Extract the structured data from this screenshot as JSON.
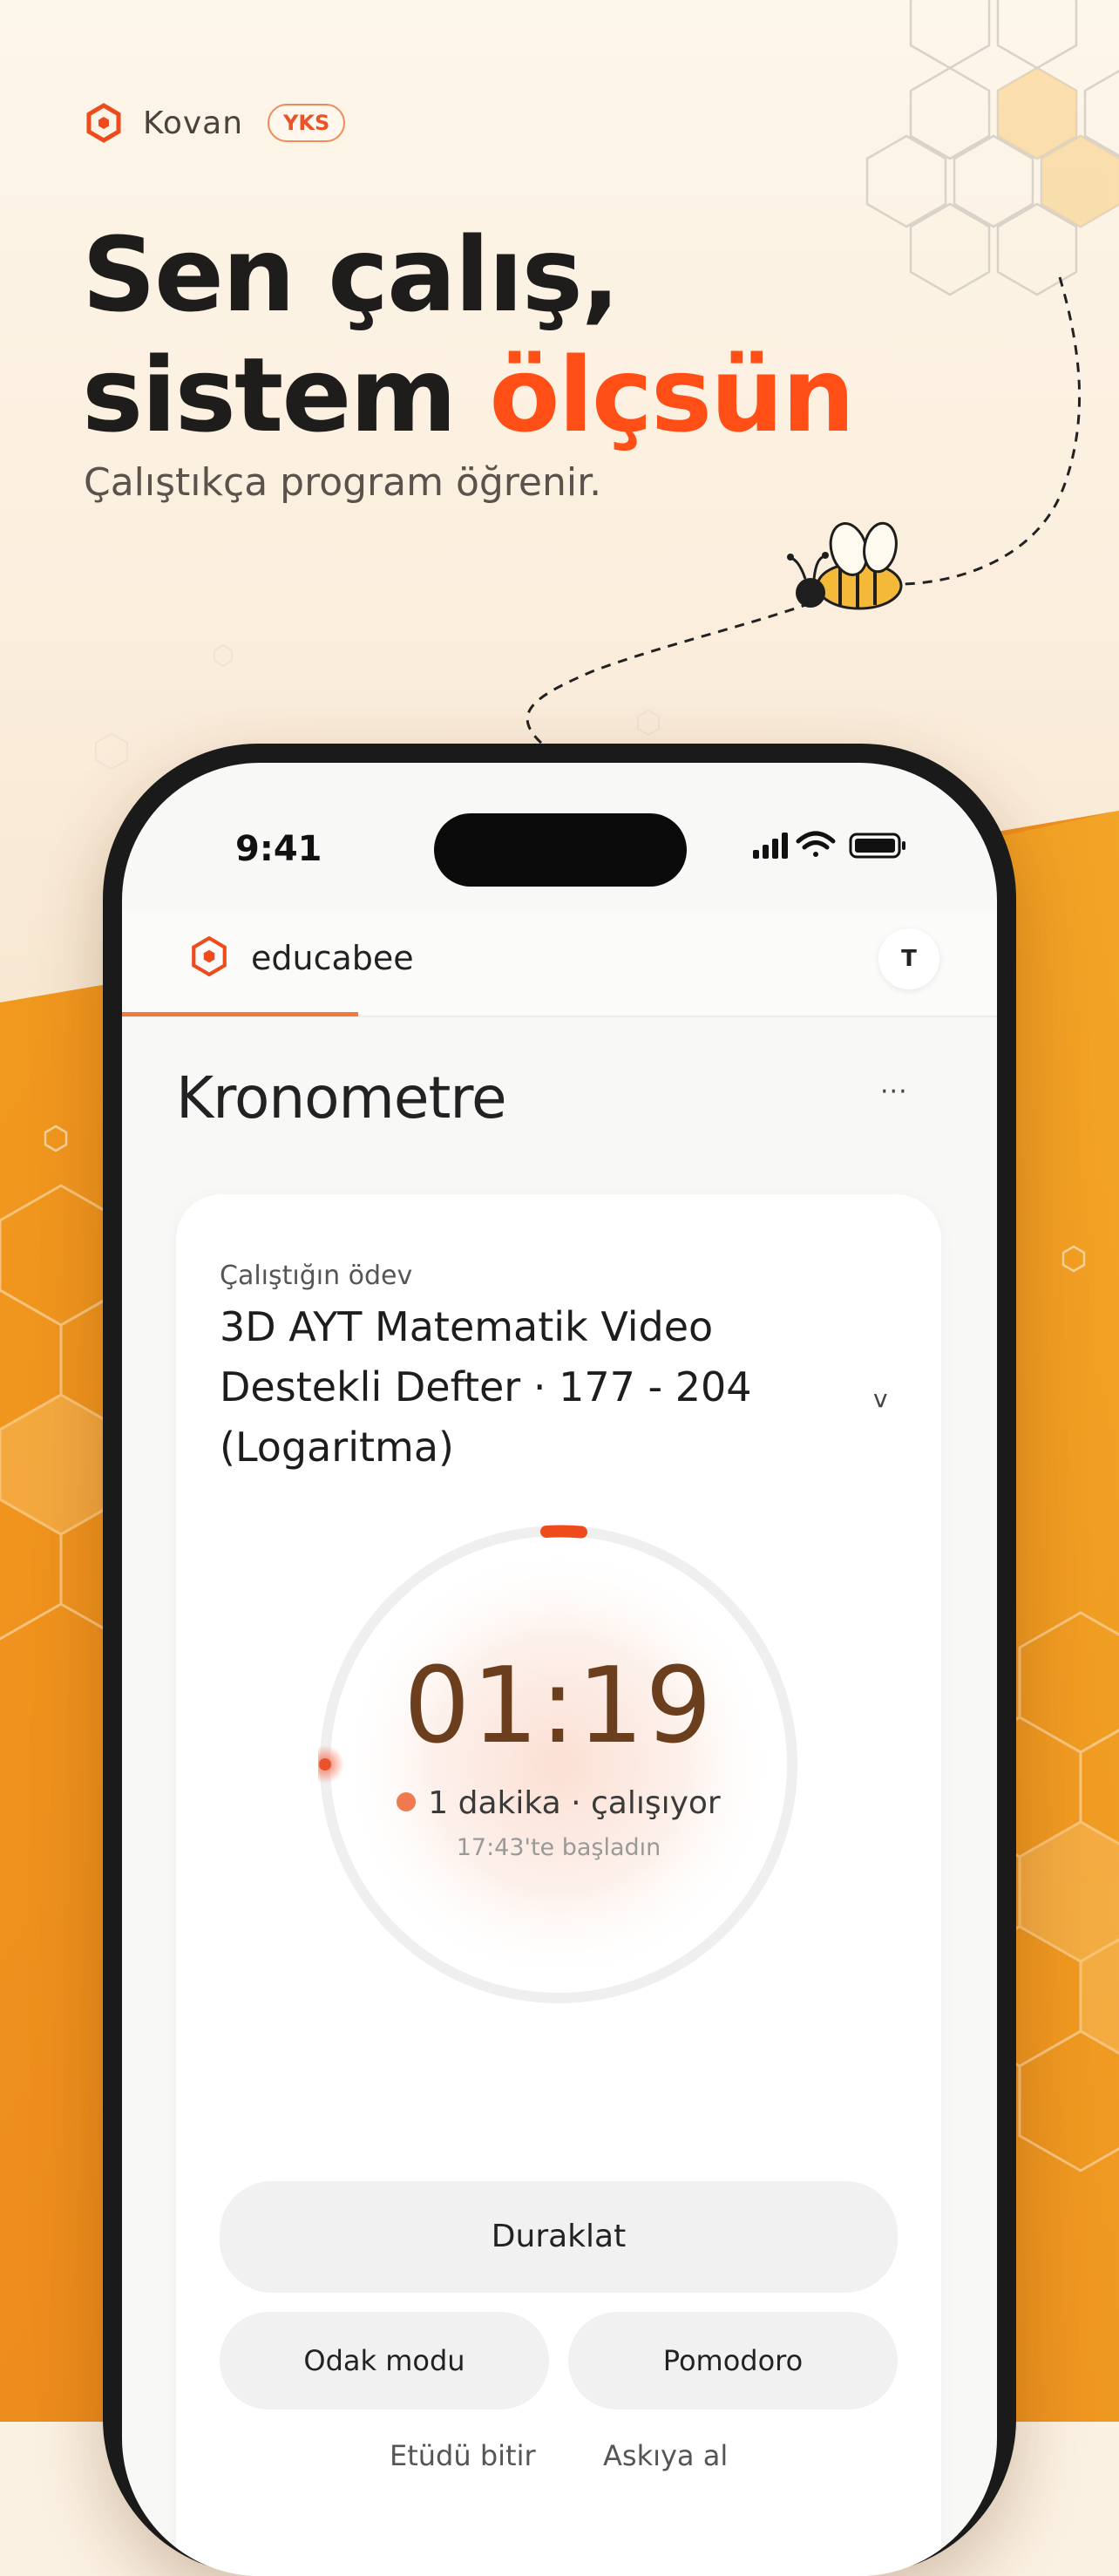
{
  "colors": {
    "accent": "#ff4f17",
    "honey": "#f5a623",
    "orange_bg": "#ee8a1c",
    "timer_text": "#6b3f1e"
  },
  "brand": {
    "name": "Kovan",
    "badge": "YKS",
    "logo_icon": "hexagon-logo-icon"
  },
  "hero": {
    "line1": "Sen çalış,",
    "line2_plain": "sistem ",
    "line2_accent": "ölçsün",
    "subtitle": "Çalıştıkça program öğrenir."
  },
  "phone": {
    "status": {
      "time": "9:41",
      "icons": [
        "signal-icon",
        "wifi-icon",
        "battery-icon"
      ]
    },
    "app": {
      "name": "educabee",
      "avatar_initial": "T",
      "page_title": "Kronometre",
      "more": "···",
      "progress": 0.27
    },
    "task": {
      "label": "Çalıştığın ödev",
      "title": "3D AYT Matematik Video Destekli Defter · 177 - 204 (Logaritma)",
      "chevron": "v"
    },
    "timer": {
      "value": "01:19",
      "status": "1 dakika · çalışıyor",
      "started": "17:43'te başladın"
    },
    "buttons": {
      "pause": "Duraklat",
      "focus": "Odak modu",
      "pomodoro": "Pomodoro",
      "finish": "Etüdü bitir",
      "hold": "Askıya al"
    }
  }
}
